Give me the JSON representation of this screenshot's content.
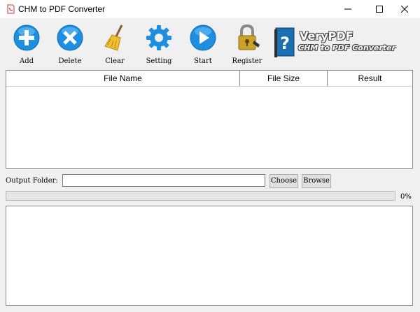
{
  "window": {
    "title": "CHM to PDF Converter"
  },
  "toolbar": {
    "add_label": "Add",
    "delete_label": "Delete",
    "clear_label": "Clear",
    "setting_label": "Setting",
    "start_label": "Start",
    "register_label": "Register"
  },
  "brand": {
    "name": "VeryPDF",
    "product": "CHM to PDF Converter"
  },
  "file_list": {
    "columns": [
      "File Name",
      "File Size",
      "Result"
    ],
    "rows": []
  },
  "output": {
    "label": "Output Folder:",
    "folder_value": "",
    "choose_label": "Choose",
    "browse_label": "Browse"
  },
  "progress": {
    "value": 0,
    "text": "0%"
  },
  "colors": {
    "accent_blue": "#1e8ee0",
    "progress_green": "#06b025"
  }
}
